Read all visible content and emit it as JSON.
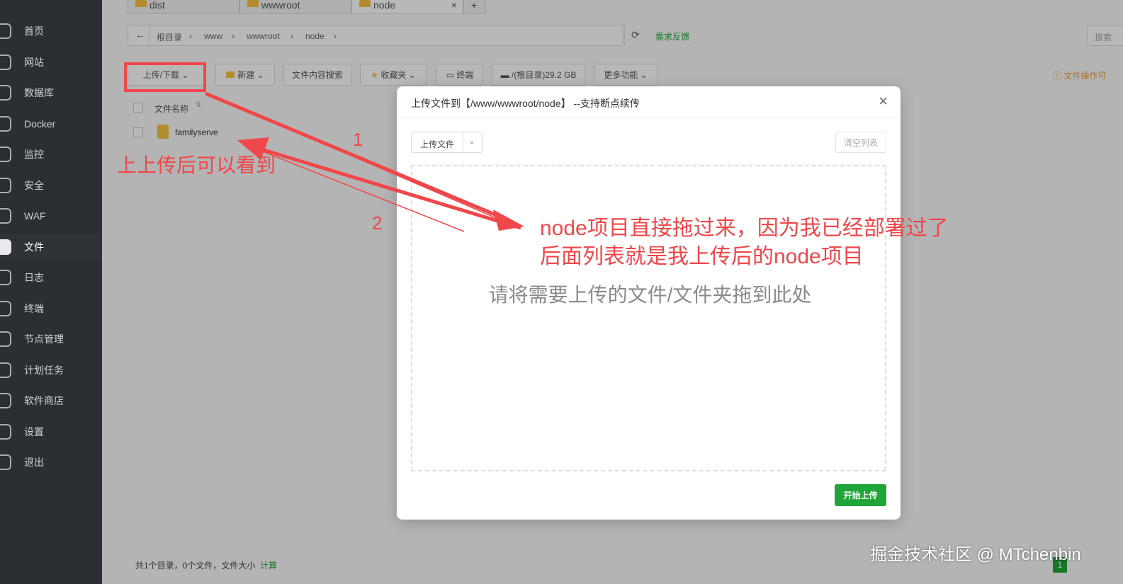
{
  "sidebar": {
    "items": [
      {
        "label": "首页",
        "icon": "home-icon"
      },
      {
        "label": "网站",
        "icon": "globe-icon"
      },
      {
        "label": "数据库",
        "icon": "database-icon"
      },
      {
        "label": "Docker",
        "icon": "docker-icon"
      },
      {
        "label": "监控",
        "icon": "monitor-icon"
      },
      {
        "label": "安全",
        "icon": "shield-icon"
      },
      {
        "label": "WAF",
        "icon": "waf-icon"
      },
      {
        "label": "文件",
        "icon": "folder-icon"
      },
      {
        "label": "日志",
        "icon": "log-icon"
      },
      {
        "label": "终端",
        "icon": "terminal-icon"
      },
      {
        "label": "节点管理",
        "icon": "cube-icon"
      },
      {
        "label": "计划任务",
        "icon": "calendar-icon"
      },
      {
        "label": "软件商店",
        "icon": "apps-icon"
      },
      {
        "label": "设置",
        "icon": "gear-icon"
      },
      {
        "label": "退出",
        "icon": "logout-icon"
      }
    ],
    "active": "文件"
  },
  "tabs": [
    {
      "label": "dist"
    },
    {
      "label": "wwwroot"
    },
    {
      "label": "node",
      "close": "×"
    }
  ],
  "tab_add": "+",
  "breadcrumb": {
    "back": "←",
    "items": [
      "根目录",
      "www",
      "wwwroot",
      "node"
    ],
    "refresh": "⟳",
    "feedback": "需求反馈",
    "search": "搜索"
  },
  "toolbar": {
    "upload": "上传/下载",
    "new": "新建",
    "content_search": "文件内容搜索",
    "favorites": "收藏夹",
    "terminal": "终端",
    "disk": "/(根目录)29.2 GB",
    "more": "更多功能",
    "op_hint": "文件操作可"
  },
  "file_list": {
    "header": "文件名称",
    "rows": [
      {
        "name": "familyserve"
      }
    ]
  },
  "footer": {
    "summary": "共1个目录，0个文件，文件大小",
    "calc": "计算",
    "page": "1"
  },
  "modal": {
    "title": "上传文件到【/www/wwwroot/node】 --支持断点续传",
    "close": "×",
    "upload_select": "上传文件",
    "clear": "清空列表",
    "drop_hint": "请将需要上传的文件/文件夹拖到此处",
    "start": "开始上传"
  },
  "annotations": {
    "left_note": "上上传后可以看到",
    "num1": "1",
    "num2": "2",
    "main_line1": "node项目直接拖过来，因为我已经部署过了",
    "main_line2": "后面列表就是我上传后的node项目",
    "color": "#f0474a"
  },
  "watermark": "掘金技术社区 @ MTchenbin"
}
